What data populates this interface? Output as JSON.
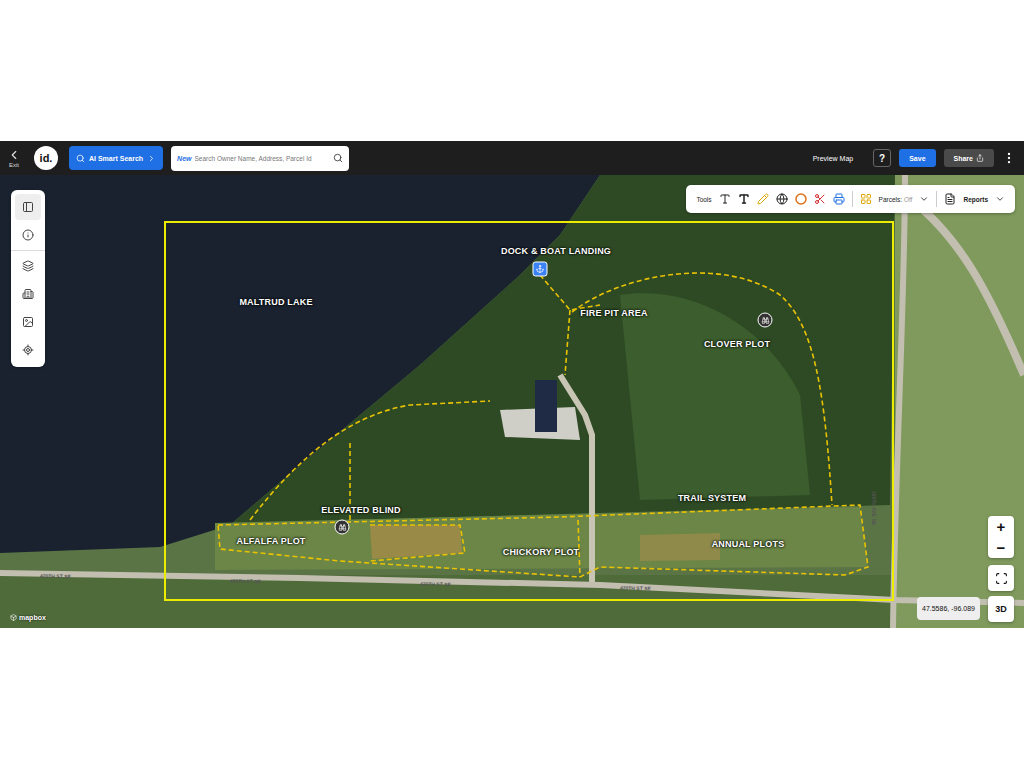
{
  "toolbar": {
    "exit": "Exit",
    "logo": "id.",
    "ai_search": "AI Smart Search",
    "search_badge": "New",
    "search_placeholder": "Search Owner Name, Address, Parcel Id",
    "preview": "Preview Map",
    "help": "?",
    "save": "Save",
    "share": "Share"
  },
  "map_tools": {
    "label": "Tools",
    "parcels": "Parcels:",
    "parcels_state": "Off",
    "reports": "Reports"
  },
  "map_labels": [
    "MALTRUD LAKE",
    "DOCK & BOAT LANDING",
    "FIRE PIT AREA",
    "CLOVER PLOT",
    "TRAIL SYSTEM",
    "ELEVATED BLIND",
    "ALFALFA PLOT",
    "CHICKORY PLOT",
    "ANNUAL PLOTS"
  ],
  "road_labels": [
    {
      "text": "420TH ST SE",
      "kind": "horizontal"
    },
    {
      "text": "420TH ST SE",
      "kind": "horizontal"
    },
    {
      "text": "420TH ST SE",
      "kind": "horizontal"
    },
    {
      "text": "420TH ST SE",
      "kind": "horizontal"
    },
    {
      "text": "190TH AVE SE",
      "kind": "vertical"
    }
  ],
  "map_controls": {
    "zoom_in": "+",
    "zoom_out": "−",
    "coordinates": "47.5586, -96.089",
    "three_d": "3D",
    "attribution": "mapbox"
  }
}
